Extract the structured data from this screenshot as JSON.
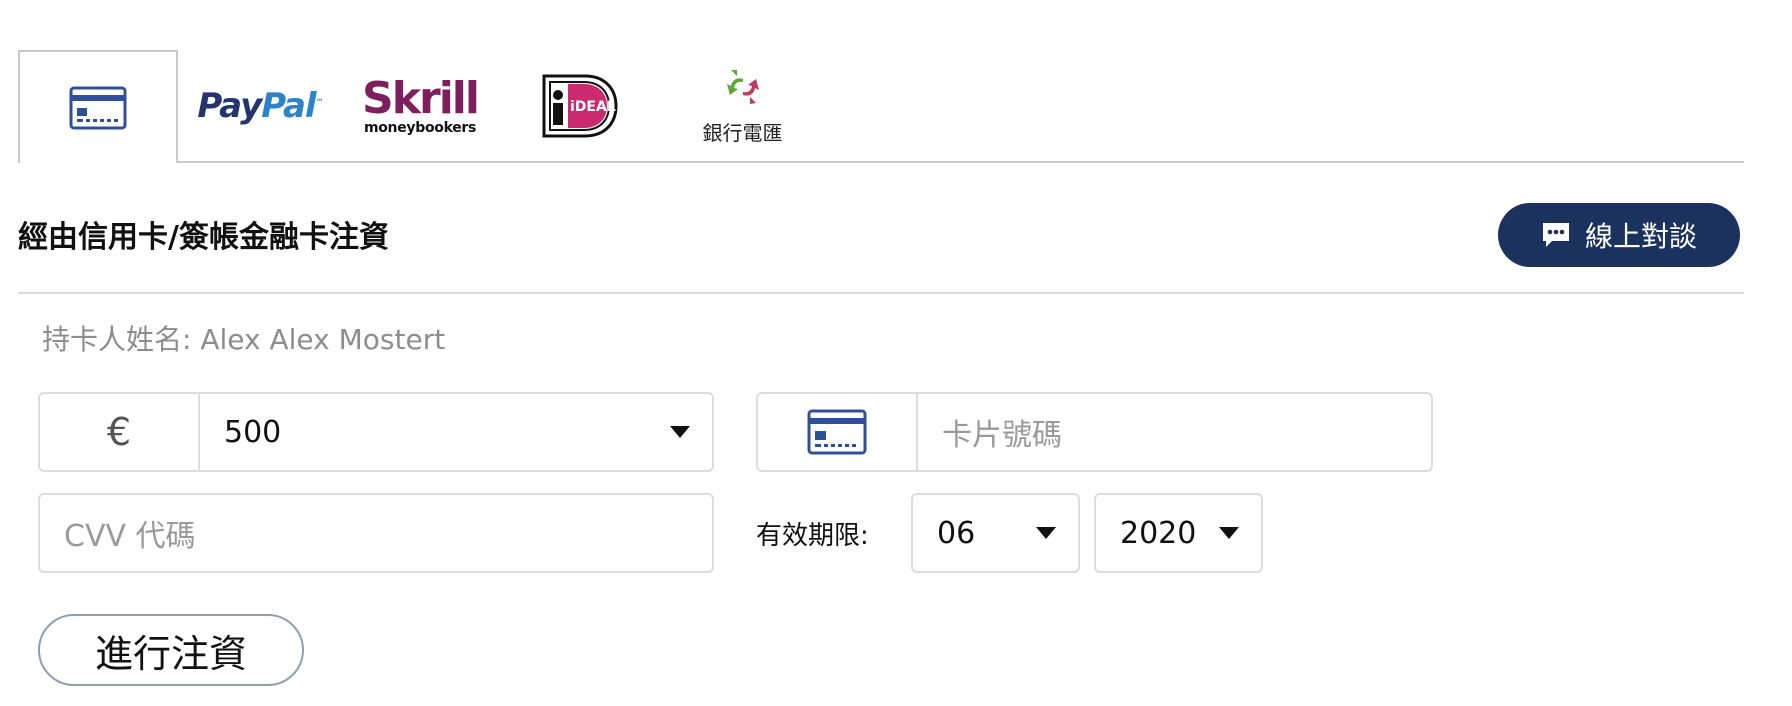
{
  "payment_tabs": {
    "card": {
      "icon": "credit-card-icon",
      "active": true
    },
    "paypal": {
      "word_pay": "Pay",
      "word_pal": "Pal",
      "tm": "™"
    },
    "skrill": {
      "word": "Skrill",
      "sub": "moneybookers"
    },
    "ideal": {
      "word": "iDEAL"
    },
    "bank_transfer": {
      "label": "銀行電匯",
      "icon": "recycle-arrows-icon"
    }
  },
  "section": {
    "title": "經由信用卡/簽帳金融卡注資",
    "chat_button_label": "線上對談",
    "chat_icon": "chat-bubble-icon"
  },
  "cardholder": {
    "text": "持卡人姓名: Alex Alex Mostert"
  },
  "form": {
    "currency_symbol": "€",
    "amount_value": "500",
    "card_number_placeholder": "卡片號碼",
    "cvv_placeholder": "CVV 代碼",
    "expiry_label": "有效期限:",
    "expiry_month": "06",
    "expiry_year": "2020",
    "submit_label": "進行注資"
  },
  "colors": {
    "brand_navy": "#1b325f",
    "card_icon_blue": "#2f4f9b",
    "paypal_dark": "#22356f",
    "paypal_light": "#2b83c9",
    "skrill_purple": "#7e1e5d",
    "ideal_pink": "#cc2a6e",
    "arrow_green": "#5aa83a",
    "arrow_red": "#c23a5b"
  }
}
